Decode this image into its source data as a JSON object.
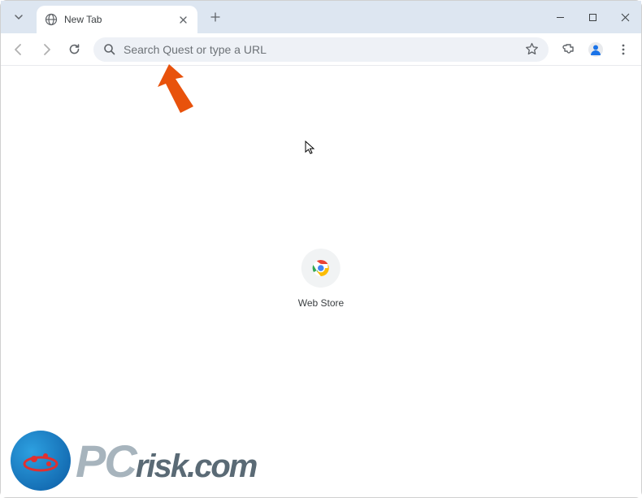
{
  "tab": {
    "title": "New Tab"
  },
  "omnibox": {
    "placeholder": "Search Quest or type a URL"
  },
  "shortcut": {
    "label": "Web Store"
  },
  "watermark": {
    "pc": "PC",
    "risk": "risk",
    "com": ".com"
  }
}
